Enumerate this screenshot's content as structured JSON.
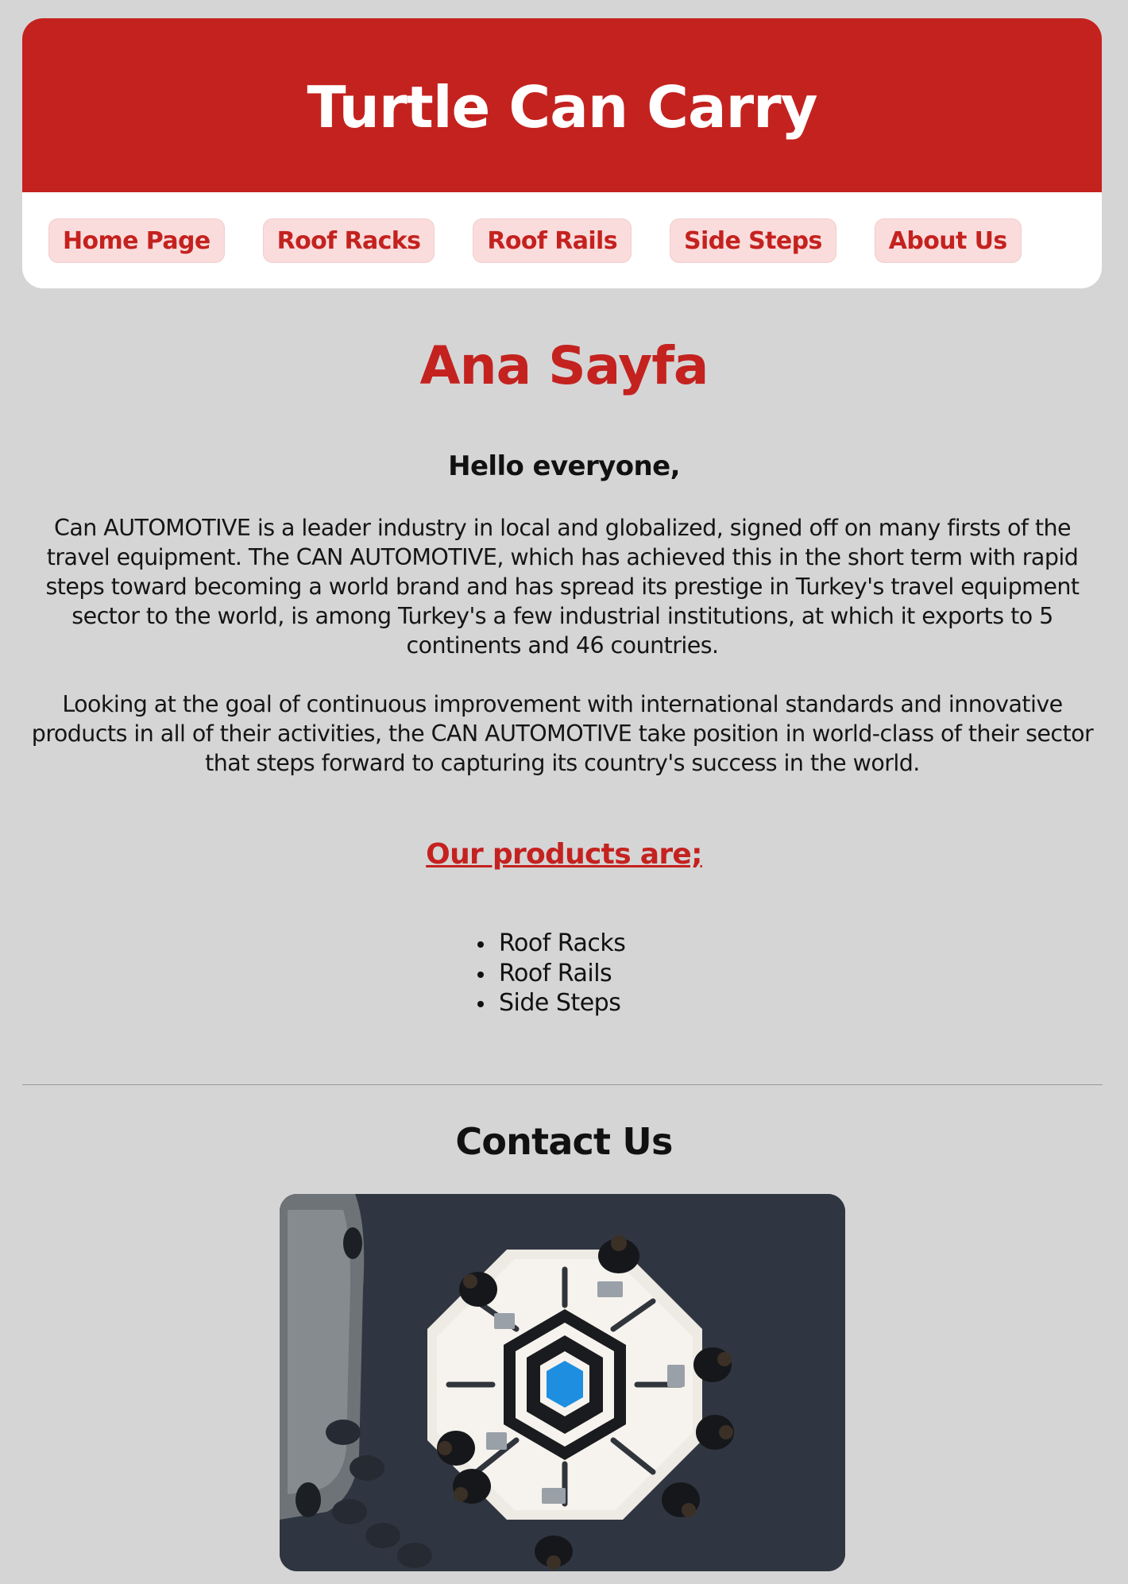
{
  "header": {
    "title": "Turtle Can Carry",
    "nav": [
      "Home Page",
      "Roof Racks",
      "Roof Rails",
      "Side Steps",
      "About Us"
    ]
  },
  "main": {
    "page_title": "Ana Sayfa",
    "greeting": "Hello everyone,",
    "paragraph_1": "Can AUTOMOTIVE is a leader industry in local and globalized, signed off on many firsts of the travel equipment. The CAN AUTOMOTIVE, which has achieved this in the short term with rapid steps toward becoming a world brand and has spread its prestige in Turkey's travel equipment sector to the world, is among Turkey's a few industrial institutions, at which it exports to 5 continents and 46 countries.",
    "paragraph_2": "Looking at the goal of continuous improvement with international standards and innovative products in all of their activities, the CAN AUTOMOTIVE take position in world-class of their sector that steps forward to capturing its country's success in the world.",
    "products_heading": "Our products are;",
    "products": [
      "Roof Racks",
      "Roof Rails",
      "Side Steps"
    ]
  },
  "contact": {
    "heading": "Contact Us"
  },
  "colors": {
    "brand_red": "#c4221f",
    "nav_pill": "#fadcdc",
    "page_bg": "#d5d5d6"
  }
}
